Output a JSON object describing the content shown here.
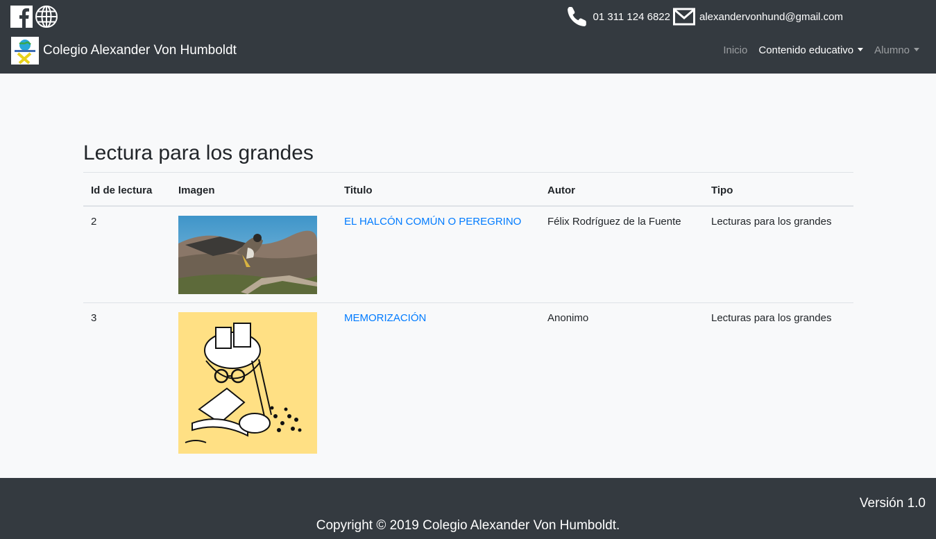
{
  "header": {
    "phone": "01 311 124 6822",
    "email": "alexandervonhund@gmail.com",
    "brand_name": "Colegio Alexander Von Humboldt",
    "nav": [
      {
        "label": "Inicio"
      },
      {
        "label": "Contenido educativo"
      },
      {
        "label": "Alumno"
      }
    ]
  },
  "main": {
    "title": "Lectura para los grandes",
    "columns": [
      "Id de lectura",
      "Imagen",
      "Titulo",
      "Autor",
      "Tipo"
    ],
    "rows": [
      {
        "id": "2",
        "titulo": "EL HALCÓN COMÚN O PEREGRINO",
        "autor": "Félix Rodríguez de la Fuente",
        "tipo": "Lecturas para los grandes"
      },
      {
        "id": "3",
        "titulo": "MEMORIZACIÓN",
        "autor": "Anonimo",
        "tipo": "Lecturas para los grandes"
      }
    ]
  },
  "footer": {
    "version": "Versión 1.0",
    "copyright": "Copyright © 2019 Colegio Alexander Von Humboldt."
  },
  "colors": {
    "navbar": "#343a40",
    "link": "#007bff",
    "background": "#f8f9fa"
  }
}
